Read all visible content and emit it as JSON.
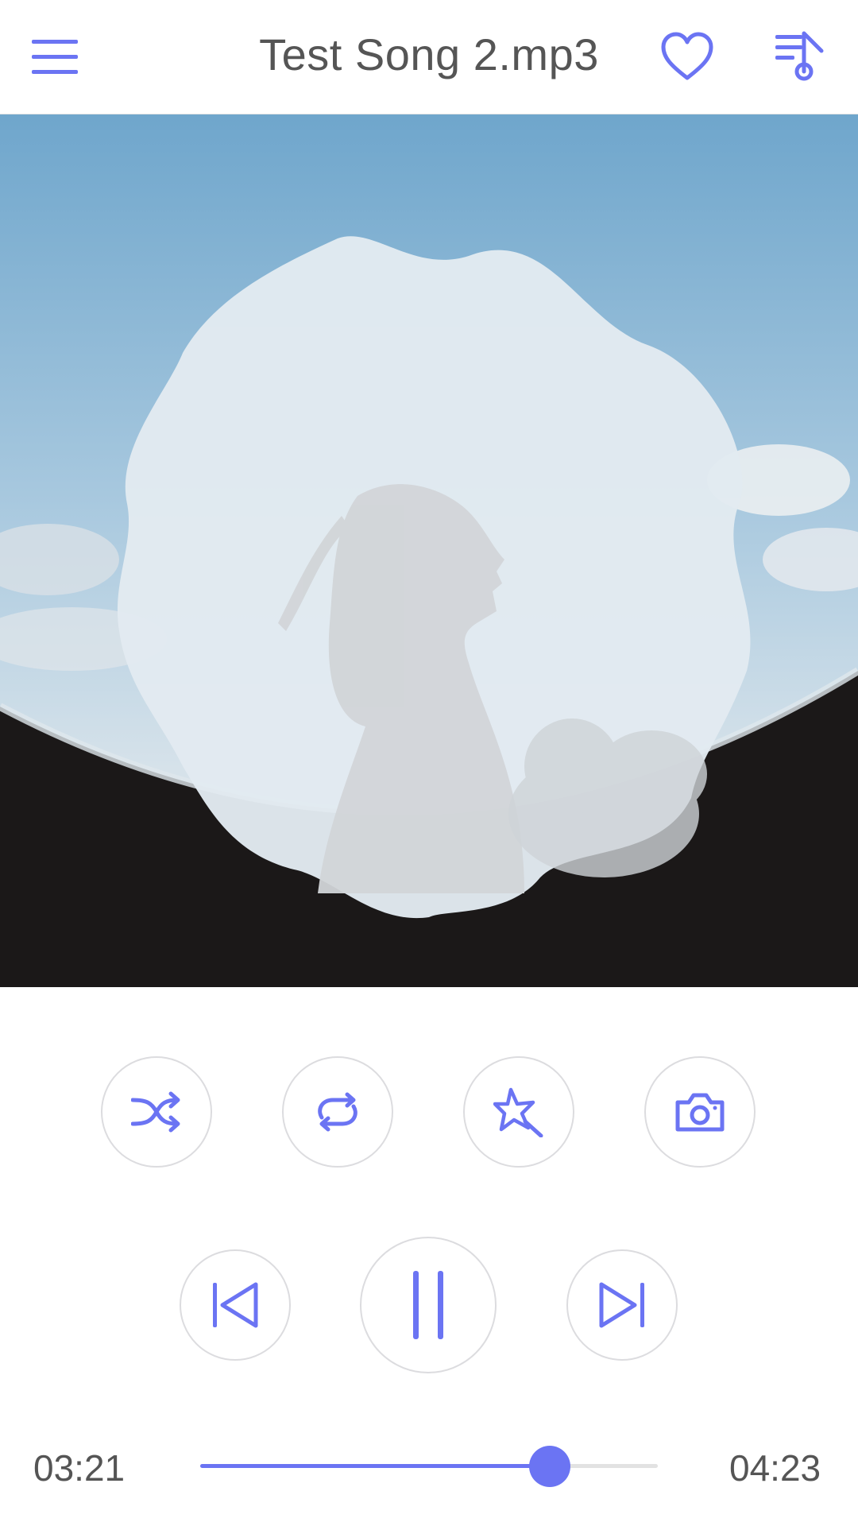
{
  "header": {
    "title": "Test Song 2.mp3",
    "menu_icon": "hamburger-menu-icon",
    "favorite_icon": "heart-icon",
    "playlist_icon": "playlist-music-icon"
  },
  "artwork": {
    "shape": "wavy-circle",
    "icon": "album-art-image"
  },
  "controls": {
    "top_row": [
      {
        "name": "shuffle",
        "icon": "shuffle-icon"
      },
      {
        "name": "repeat",
        "icon": "repeat-icon"
      },
      {
        "name": "effects",
        "icon": "magic-star-icon"
      },
      {
        "name": "snapshot",
        "icon": "camera-icon"
      }
    ],
    "bottom_row": [
      {
        "name": "previous",
        "icon": "skip-previous-icon"
      },
      {
        "name": "pause",
        "icon": "pause-icon"
      },
      {
        "name": "next",
        "icon": "skip-next-icon"
      }
    ]
  },
  "progress": {
    "current_time": "03:21",
    "total_time": "04:23",
    "fraction": 0.7633
  },
  "colors": {
    "accent": "#6b74f3",
    "text": "#555555",
    "circle_border": "#dcdcdf"
  }
}
